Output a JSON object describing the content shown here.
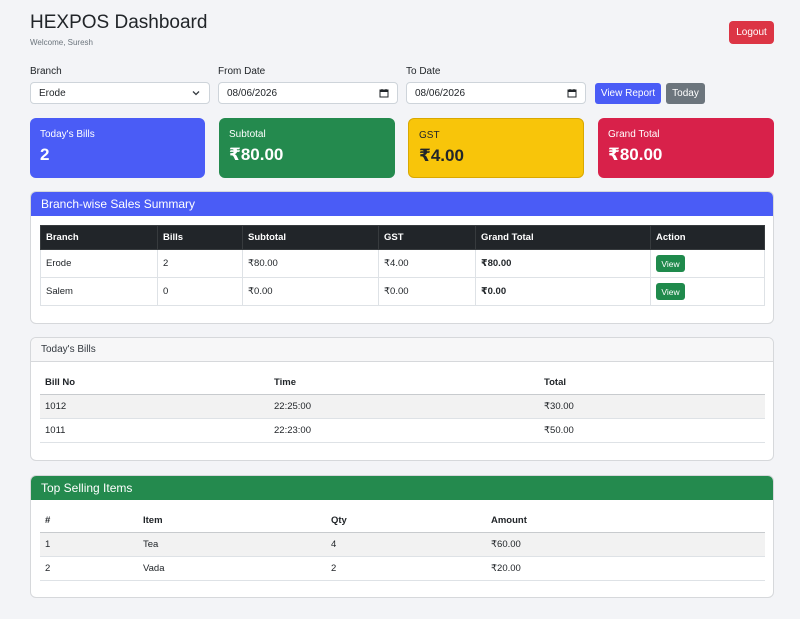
{
  "header": {
    "title": "HEXPOS Dashboard",
    "welcome": "Welcome, Suresh",
    "logout_label": "Logout"
  },
  "filters": {
    "branch_label": "Branch",
    "branch_value": "Erode",
    "from_label": "From Date",
    "from_value": "08/06/2026",
    "to_label": "To Date",
    "to_value": "08/06/2026",
    "view_report_label": "View Report",
    "today_label": "Today"
  },
  "stats": [
    {
      "label": "Today's Bills",
      "value": "2",
      "bg": "#4a5cf6",
      "fg": "#ffffff"
    },
    {
      "label": "Subtotal",
      "value": "₹80.00",
      "bg": "#248a4e",
      "fg": "#ffffff"
    },
    {
      "label": "GST",
      "value": "₹4.00",
      "bg": "#f8c50a",
      "fg": "#212529"
    },
    {
      "label": "Grand Total",
      "value": "₹80.00",
      "bg": "#d8214a",
      "fg": "#ffffff"
    }
  ],
  "branch_summary": {
    "title": "Branch-wise Sales Summary",
    "header_bg": "#4a5cf6",
    "columns": [
      "Branch",
      "Bills",
      "Subtotal",
      "GST",
      "Grand Total",
      "Action"
    ],
    "rows": [
      {
        "branch": "Erode",
        "bills": "2",
        "subtotal": "₹80.00",
        "gst": "₹4.00",
        "grand_total": "₹80.00",
        "action": "View"
      },
      {
        "branch": "Salem",
        "bills": "0",
        "subtotal": "₹0.00",
        "gst": "₹0.00",
        "grand_total": "₹0.00",
        "action": "View"
      }
    ]
  },
  "todays_bills": {
    "title": "Today's Bills",
    "columns": [
      "Bill No",
      "Time",
      "Total"
    ],
    "rows": [
      {
        "bill_no": "1012",
        "time": "22:25:00",
        "total": "₹30.00"
      },
      {
        "bill_no": "1011",
        "time": "22:23:00",
        "total": "₹50.00"
      }
    ]
  },
  "top_items": {
    "title": "Top Selling Items",
    "header_bg": "#248a4e",
    "columns": [
      "#",
      "Item",
      "Qty",
      "Amount"
    ],
    "rows": [
      {
        "rank": "1",
        "item": "Tea",
        "qty": "4",
        "amount": "₹60.00"
      },
      {
        "rank": "2",
        "item": "Vada",
        "qty": "2",
        "amount": "₹20.00"
      }
    ]
  }
}
